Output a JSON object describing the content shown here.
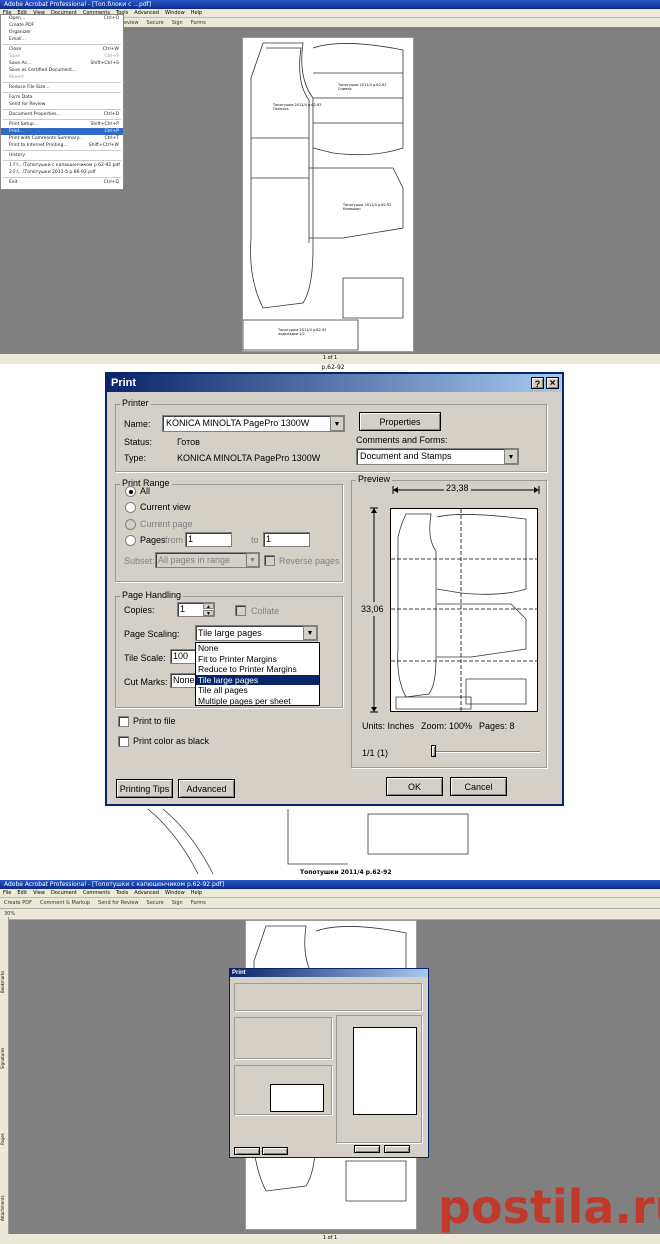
{
  "panel1": {
    "title": "Adobe Acrobat Professional - [Топ.блоки с ...pdf]",
    "menubar": [
      "File",
      "Edit",
      "View",
      "Document",
      "Comments",
      "Tools",
      "Advanced",
      "Window",
      "Help"
    ],
    "toolbar": [
      "Create PDF",
      "Comment & Markup",
      "Send for Review",
      "Secure",
      "Sign",
      "Forms"
    ],
    "file_menu": [
      {
        "label": "Open...",
        "shortcut": "Ctrl+O"
      },
      {
        "label": "Create PDF",
        "shortcut": ""
      },
      {
        "label": "Organizer",
        "shortcut": ""
      },
      {
        "label": "Email...",
        "shortcut": ""
      },
      {
        "label": "Close",
        "shortcut": "Ctrl+W"
      },
      {
        "label": "Save",
        "shortcut": "Ctrl+S"
      },
      {
        "label": "Save As...",
        "shortcut": "Shift+Ctrl+S"
      },
      {
        "label": "Save as Certified Document...",
        "shortcut": ""
      },
      {
        "label": "Revert",
        "shortcut": ""
      },
      {
        "label": "Reduce File Size...",
        "shortcut": ""
      },
      {
        "label": "Form Data",
        "shortcut": ""
      },
      {
        "label": "Send for Review",
        "shortcut": ""
      },
      {
        "label": "Document Properties...",
        "shortcut": "Ctrl+D"
      },
      {
        "label": "Print Setup...",
        "shortcut": "Shift+Ctrl+P"
      },
      {
        "label": "Print...",
        "shortcut": "Ctrl+P"
      },
      {
        "label": "Print with Comments Summary...",
        "shortcut": "Ctrl+T"
      },
      {
        "label": "Print to Internet Printing...",
        "shortcut": "Shift+Ctrl+W"
      },
      {
        "label": "History",
        "shortcut": ""
      },
      {
        "label": "1 F:\\...\\Топотушки с капюшончиком р.62-92.pdf",
        "shortcut": ""
      },
      {
        "label": "2 F:\\...\\Топотушки 2011-5 р.86-92.pdf",
        "shortcut": ""
      },
      {
        "label": "Exit",
        "shortcut": "Ctrl+Q"
      }
    ],
    "page_labels": [
      "Топотушки 2011/4 р.62-92",
      "Полочка",
      "Топотушки 2011/4 р.62-92",
      "Спинка",
      "Топотушки 2011/4 р.62-92",
      "Капюшон",
      "Топотушки 2011/4 р.62-92",
      "подкладка 1/2"
    ],
    "status_page": "1 of 1"
  },
  "dialog": {
    "title": "Print",
    "help_btn": "?",
    "close_btn": "×",
    "printer": {
      "group": "Printer",
      "name_label": "Name:",
      "name_value": "KONICA MINOLTA PagePro 1300W",
      "properties_btn": "Properties",
      "status_label": "Status:",
      "status_value": "Готов",
      "type_label": "Type:",
      "type_value": "KONICA MINOLTA PagePro 1300W",
      "comments_label": "Comments and Forms:",
      "comments_value": "Document and Stamps"
    },
    "print_range": {
      "group": "Print Range",
      "all": "All",
      "current_view": "Current view",
      "current_page": "Current page",
      "pages": "Pages",
      "from_label": "from",
      "from_value": "1",
      "to_label": "to",
      "to_value": "1",
      "subset_label": "Subset:",
      "subset_value": "All pages in range",
      "reverse": "Reverse pages"
    },
    "page_handling": {
      "group": "Page Handling",
      "copies_label": "Copies:",
      "copies_value": "1",
      "collate": "Collate",
      "scaling_label": "Page Scaling:",
      "scaling_value": "Tile large pages",
      "tile_scale_label": "Tile Scale:",
      "tile_scale_value": "100",
      "cut_marks_label": "Cut Marks:",
      "cut_marks_value": "None",
      "scaling_options": [
        "None",
        "Fit to Printer Margins",
        "Reduce to Printer Margins",
        "Tile large pages",
        "Tile all pages",
        "Multiple pages per sheet"
      ],
      "selected_option": "Tile large pages"
    },
    "print_to_file": "Print to file",
    "print_color_black": "Print color as black",
    "preview": {
      "group": "Preview",
      "width": "23,38",
      "height": "33,06",
      "units": "Units: Inches",
      "zoom": "Zoom: 100%",
      "pages": "Pages: 8",
      "page_of": "1/1 (1)"
    },
    "buttons": {
      "tips": "Printing Tips",
      "advanced": "Advanced",
      "ok": "OK",
      "cancel": "Cancel"
    }
  },
  "panel2_bg": {
    "top_label": "р.62-92",
    "bottom_label1": "Топотушки 2011/4 р.62-92",
    "bottom_label2": "подкладка 1/2"
  },
  "panel3": {
    "title": "Adobe Acrobat Professional - [Топотушки с капюшончиком р.62-92.pdf]",
    "side_tabs": [
      "Bookmarks",
      "Signatures",
      "Pages",
      "Attachments"
    ],
    "zoom": "30%",
    "status_page": "1 of 1",
    "watermark": "postila.ru",
    "small_dialog_title": "Print"
  }
}
